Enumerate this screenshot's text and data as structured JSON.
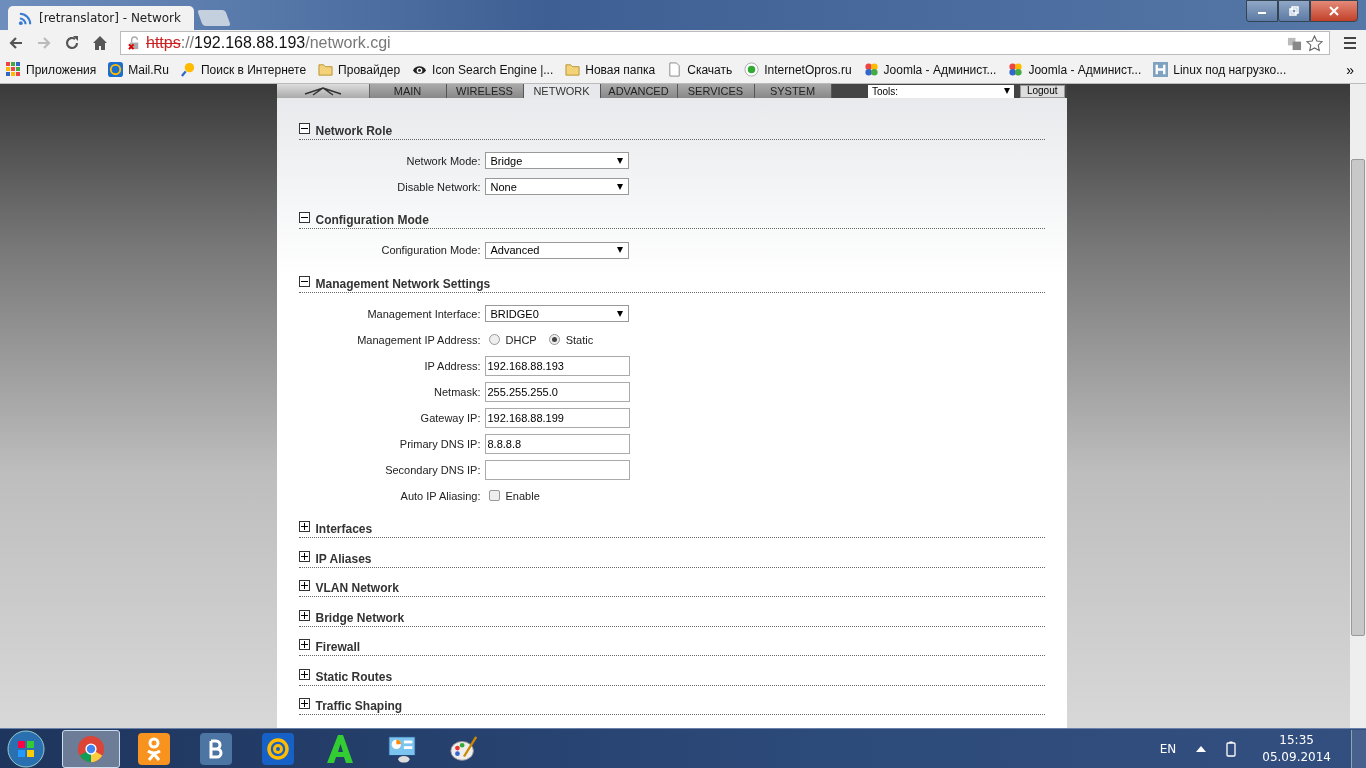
{
  "browser": {
    "tab_title": "[retranslator] - Network",
    "url": {
      "scheme": "https",
      "separator": "://",
      "host": "192.168.88.193",
      "path": "/network.cgi"
    },
    "bookmarks": [
      {
        "label": "Приложения",
        "kind": "apps"
      },
      {
        "label": "Mail.Ru",
        "kind": "mail"
      },
      {
        "label": "Поиск в Интернете",
        "kind": "search"
      },
      {
        "label": "Провайдер",
        "kind": "folder"
      },
      {
        "label": "Icon Search Engine |...",
        "kind": "eye"
      },
      {
        "label": "Новая папка",
        "kind": "folder"
      },
      {
        "label": "Скачать",
        "kind": "page"
      },
      {
        "label": "InternetOpros.ru",
        "kind": "dot"
      },
      {
        "label": "Joomla - Админист...",
        "kind": "joomla"
      },
      {
        "label": "Joomla - Админист...",
        "kind": "joomla"
      },
      {
        "label": "Linux под нагрузко...",
        "kind": "h"
      }
    ],
    "more": "»"
  },
  "nav_tabs": [
    {
      "label": "MAIN",
      "selected": false
    },
    {
      "label": "WIRELESS",
      "selected": false
    },
    {
      "label": "NETWORK",
      "selected": true
    },
    {
      "label": "ADVANCED",
      "selected": false
    },
    {
      "label": "SERVICES",
      "selected": false
    },
    {
      "label": "SYSTEM",
      "selected": false
    }
  ],
  "tools": {
    "value": "Tools:"
  },
  "logout": "Logout",
  "sections": [
    {
      "title": "Network Role",
      "expanded": true,
      "fields": [
        {
          "label": "Network Mode:",
          "kind": "select",
          "value": "Bridge"
        },
        {
          "label": "Disable Network:",
          "kind": "select",
          "value": "None"
        }
      ]
    },
    {
      "title": "Configuration Mode",
      "expanded": true,
      "fields": [
        {
          "label": "Configuration Mode:",
          "kind": "select",
          "value": "Advanced"
        }
      ]
    },
    {
      "title": "Management Network Settings",
      "expanded": true,
      "fields": [
        {
          "label": "Management Interface:",
          "kind": "select",
          "value": "BRIDGE0"
        },
        {
          "label": "Management IP Address:",
          "kind": "radio",
          "options": [
            {
              "label": "DHCP",
              "selected": false
            },
            {
              "label": "Static",
              "selected": true
            }
          ]
        },
        {
          "label": "IP Address:",
          "kind": "text",
          "value": "192.168.88.193"
        },
        {
          "label": "Netmask:",
          "kind": "text",
          "value": "255.255.255.0"
        },
        {
          "label": "Gateway IP:",
          "kind": "text",
          "value": "192.168.88.199"
        },
        {
          "label": "Primary DNS IP:",
          "kind": "text",
          "value": "8.8.8.8"
        },
        {
          "label": "Secondary DNS IP:",
          "kind": "text"
        },
        {
          "label": "Auto IP Aliasing:",
          "kind": "checkbox",
          "option": "Enable",
          "checked": false
        }
      ]
    },
    {
      "title": "Interfaces",
      "expanded": false
    },
    {
      "title": "IP Aliases",
      "expanded": false
    },
    {
      "title": "VLAN Network",
      "expanded": false
    },
    {
      "title": "Bridge Network",
      "expanded": false
    },
    {
      "title": "Firewall",
      "expanded": false
    },
    {
      "title": "Static Routes",
      "expanded": false
    },
    {
      "title": "Traffic Shaping",
      "expanded": false
    }
  ],
  "taskbar": {
    "apps": [
      {
        "kind": "chrome",
        "selected": true
      },
      {
        "kind": "ok",
        "selected": false
      },
      {
        "kind": "vk",
        "selected": false
      },
      {
        "kind": "mail",
        "selected": false
      },
      {
        "kind": "letter",
        "selected": false
      },
      {
        "kind": "panel",
        "selected": false
      },
      {
        "kind": "paint",
        "selected": false
      }
    ],
    "language": "EN",
    "time": "15:35",
    "date": "05.09.2014"
  }
}
